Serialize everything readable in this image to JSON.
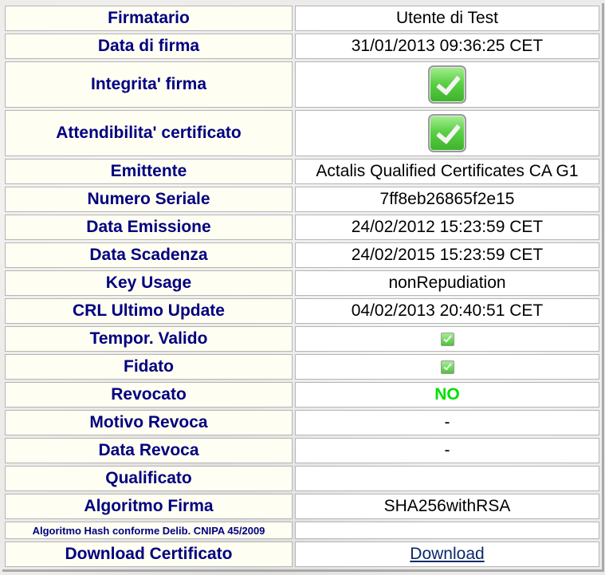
{
  "rows": {
    "firmatario": {
      "label": "Firmatario",
      "value": "Utente di Test"
    },
    "data_firma": {
      "label": "Data di firma",
      "value": "31/01/2013 09:36:25 CET"
    },
    "integrita": {
      "label": "Integrita' firma",
      "icon": "check-icon",
      "status": true
    },
    "attendibilita": {
      "label": "Attendibilita' certificato",
      "icon": "check-icon",
      "status": true
    },
    "emittente": {
      "label": "Emittente",
      "value": "Actalis Qualified Certificates CA G1"
    },
    "seriale": {
      "label": "Numero Seriale",
      "value": "7ff8eb26865f2e15"
    },
    "emissione": {
      "label": "Data Emissione",
      "value": "24/02/2012 15:23:59 CET"
    },
    "scadenza": {
      "label": "Data Scadenza",
      "value": "24/02/2015 15:23:59 CET"
    },
    "key_usage": {
      "label": "Key Usage",
      "value": "nonRepudiation"
    },
    "crl": {
      "label": "CRL Ultimo Update",
      "value": "04/02/2013 20:40:51 CET"
    },
    "temporale": {
      "label": "Tempor. Valido",
      "icon": "check-icon",
      "status": true
    },
    "fidato": {
      "label": "Fidato",
      "icon": "check-icon",
      "status": true
    },
    "revocato": {
      "label": "Revocato",
      "value": "NO",
      "color": "#00e000"
    },
    "motivo_revoca": {
      "label": "Motivo Revoca",
      "value": "-"
    },
    "data_revoca": {
      "label": "Data Revoca",
      "value": "-"
    },
    "qualificato": {
      "label": "Qualificato",
      "value": ""
    },
    "algoritmo": {
      "label": "Algoritmo Firma",
      "value": "SHA256withRSA"
    },
    "hash": {
      "label": "Algoritmo Hash conforme Delib. CNIPA 45/2009",
      "value": ""
    },
    "download": {
      "label": "Download Certificato",
      "link_text": "Download"
    }
  },
  "colors": {
    "label_text": "#000080",
    "label_bg": "#fefef2",
    "value_bg": "#ffffff",
    "no_text": "#00e000",
    "link": "#0a2a6a"
  }
}
